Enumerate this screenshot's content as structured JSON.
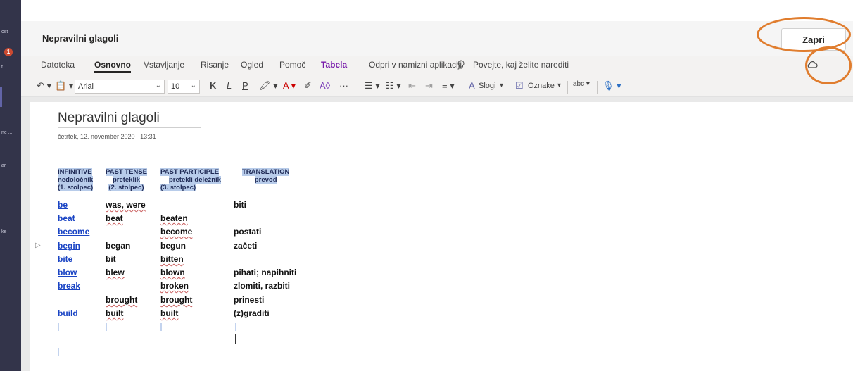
{
  "app_title": "Nepravilni glagoli",
  "close_label": "Zapri",
  "rail": {
    "items": [
      "ost",
      "t",
      "ne ...",
      "ar",
      "ke"
    ],
    "notification_count": "1"
  },
  "ribbon_tabs": [
    {
      "label": "Datoteka"
    },
    {
      "label": "Osnovno"
    },
    {
      "label": "Vstavljanje"
    },
    {
      "label": "Risanje"
    },
    {
      "label": "Ogled"
    },
    {
      "label": "Pomoč"
    },
    {
      "label": "Tabela"
    },
    {
      "label": "Odpri v namizni aplikaciji"
    }
  ],
  "tell_me": "Povejte, kaj želite narediti",
  "toolbar": {
    "undo": "↶ ▾",
    "clipboard": "📋 ▾",
    "font": "Arial",
    "size": "10",
    "bold": "K",
    "italic": "L",
    "underline": "P",
    "highlight": "🖍 ▾",
    "font_color": "A ▾",
    "format_painter": "✐",
    "clear": "A◊",
    "more": "···",
    "bullets": "☰ ▾",
    "numbering": "☷ ▾",
    "outdent": "⇤",
    "indent": "⇥",
    "align": "≡ ▾",
    "styles": "Slogi",
    "tags": "Oznake",
    "spelling": "abc ▾",
    "dictate": "🎙 ▾"
  },
  "page": {
    "title": "Nepravilni glagoli",
    "date": "četrtek, 12. november 2020",
    "time": "13:31"
  },
  "table": {
    "headers": [
      {
        "en": "INFINITIVE",
        "sl": "nedoločnik",
        "col": "(1. stolpec)"
      },
      {
        "en": "PAST TENSE",
        "sl": "preteklik",
        "col": "(2. stolpec)"
      },
      {
        "en": "PAST PARTICIPLE",
        "sl": "pretekli deležnik",
        "col": "(3. stolpec)"
      },
      {
        "en": "TRANSLATION",
        "sl": "prevod",
        "col": ""
      }
    ],
    "rows": [
      [
        "be",
        "was, were",
        "",
        "biti"
      ],
      [
        "beat",
        "beat",
        "beaten",
        ""
      ],
      [
        "become",
        "",
        "become",
        "postati"
      ],
      [
        "begin",
        "began",
        "begun",
        "začeti"
      ],
      [
        "bite",
        "bit",
        "bitten",
        ""
      ],
      [
        "blow",
        "blew",
        "blown",
        "pihati; napihniti"
      ],
      [
        "break",
        "",
        "broken",
        "zlomiti, razbiti"
      ],
      [
        "",
        "brought",
        "brought",
        "prinesti"
      ],
      [
        "build",
        "built",
        "built",
        "(z)graditi"
      ]
    ]
  },
  "colors": {
    "accent_purple": "#7719aa",
    "link_blue": "#1a44c4",
    "annotation_orange": "#e07d2e",
    "header_highlight": "#b8ccea"
  }
}
